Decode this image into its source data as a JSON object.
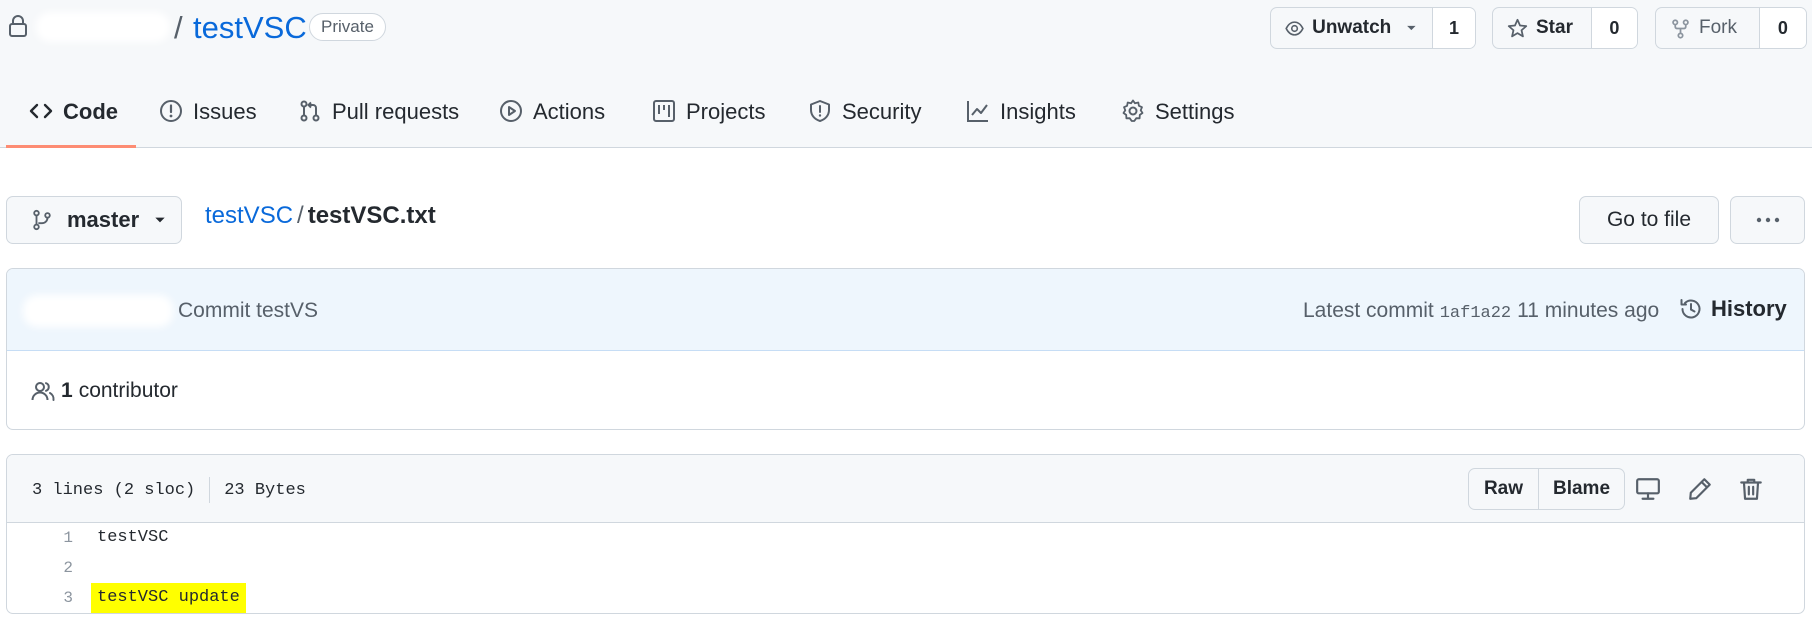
{
  "repo": {
    "separator": "/",
    "name": "testVSC",
    "visibility": "Private"
  },
  "header_buttons": {
    "unwatch_label": "Unwatch",
    "unwatch_count": "1",
    "star_label": "Star",
    "star_count": "0",
    "fork_label": "Fork",
    "fork_count": "0"
  },
  "tabs": [
    {
      "label": "Code",
      "icon": "code-icon",
      "active": true
    },
    {
      "label": "Issues",
      "icon": "issue-icon"
    },
    {
      "label": "Pull requests",
      "icon": "pull-request-icon"
    },
    {
      "label": "Actions",
      "icon": "play-icon"
    },
    {
      "label": "Projects",
      "icon": "project-icon"
    },
    {
      "label": "Security",
      "icon": "shield-icon"
    },
    {
      "label": "Insights",
      "icon": "graph-icon"
    },
    {
      "label": "Settings",
      "icon": "gear-icon"
    }
  ],
  "file_nav": {
    "branch": "master",
    "crumb_repo": "testVSC",
    "crumb_sep": "/",
    "crumb_file": "testVSC.txt",
    "goto_file_label": "Go to file"
  },
  "commit": {
    "message": "Commit testVS",
    "latest_label": "Latest commit",
    "sha": "1af1a22",
    "time": "11 minutes ago",
    "history_label": "History",
    "contributor_count": "1",
    "contributor_label": "contributor"
  },
  "file": {
    "lines_info": "3 lines (2 sloc)",
    "size": "23 Bytes",
    "raw_label": "Raw",
    "blame_label": "Blame",
    "lines": [
      {
        "num": "1",
        "text": "testVSC",
        "highlight": false
      },
      {
        "num": "2",
        "text": "",
        "highlight": false
      },
      {
        "num": "3",
        "text": "testVSC update",
        "highlight": true
      }
    ]
  },
  "colors": {
    "link": "#0969da",
    "tab_underline": "#fd8c73",
    "highlight": "#ffff00",
    "commit_bar": "#eef6fd"
  }
}
